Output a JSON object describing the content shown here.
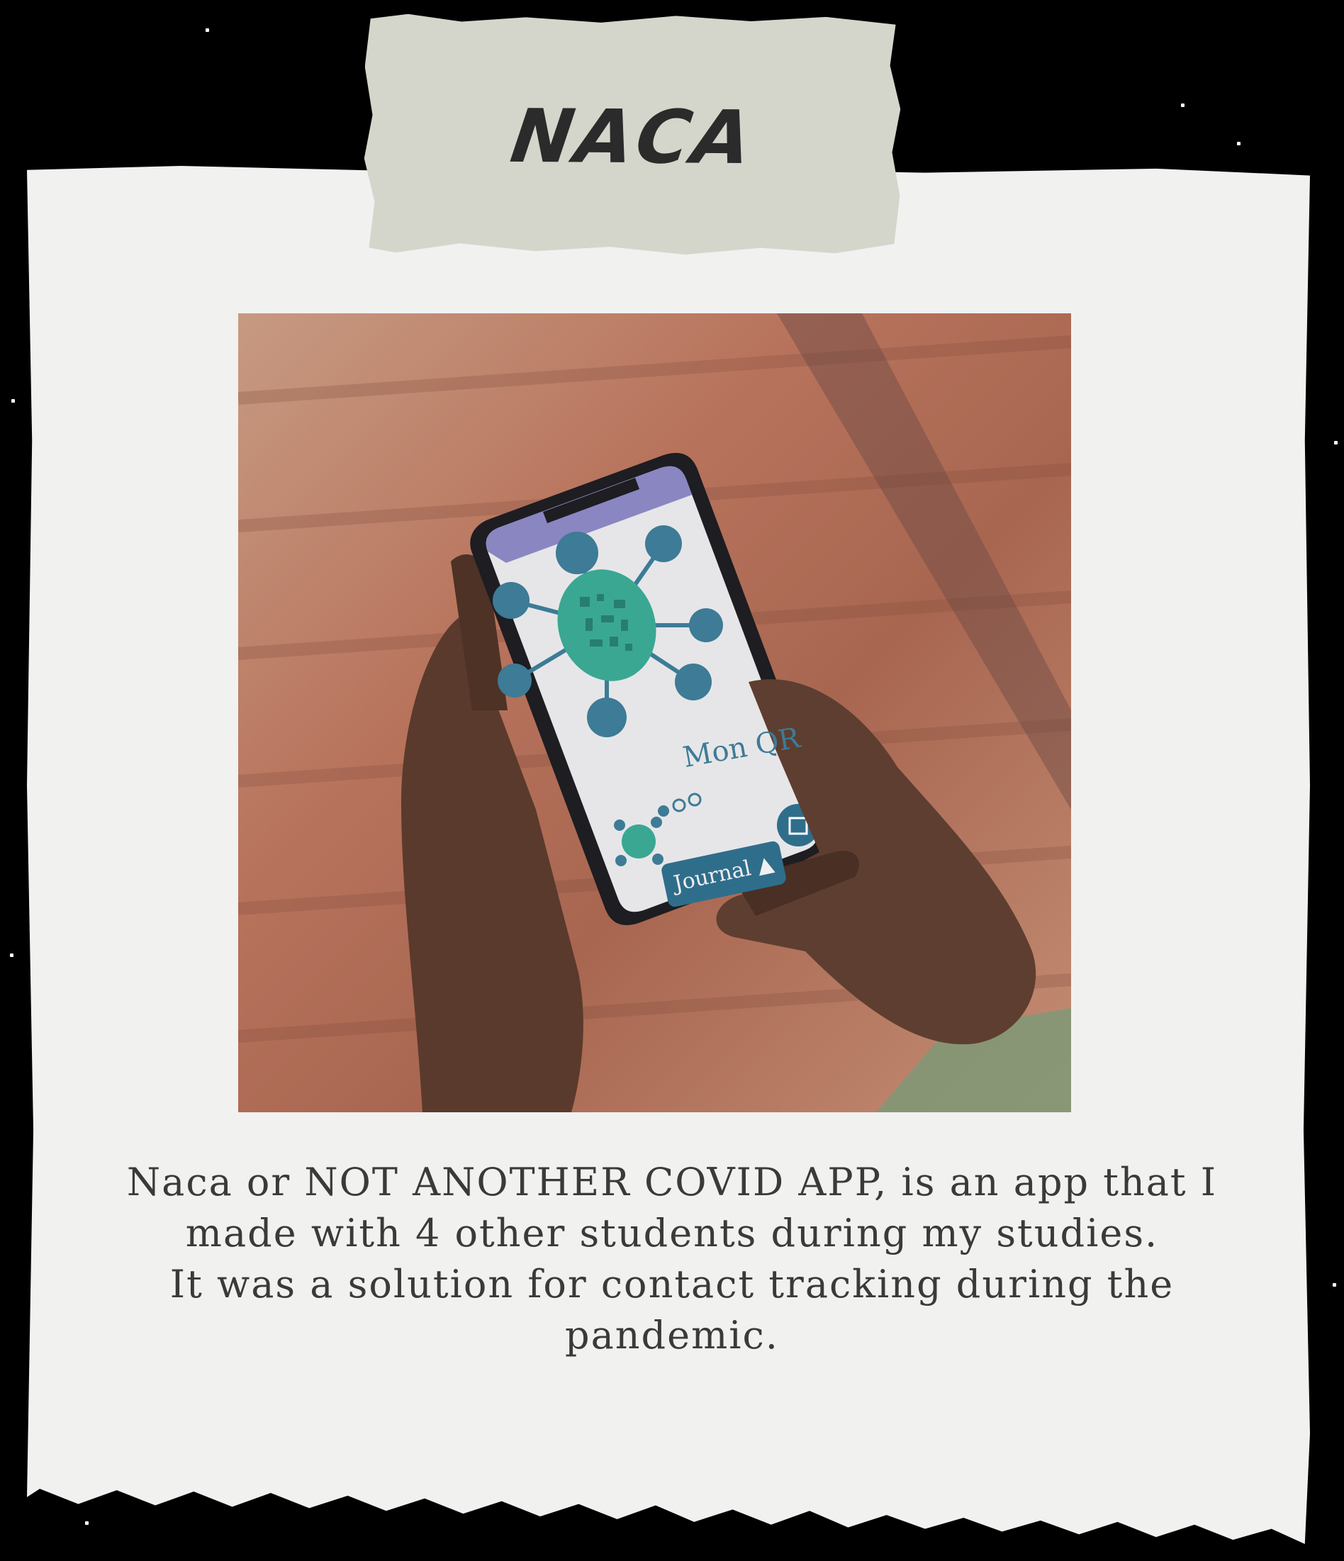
{
  "tape": {
    "logo_text": "NACA"
  },
  "phone_screen": {
    "title": "Mon QR",
    "journal_button_label": "Journal",
    "page_indicator_total": 3,
    "page_indicator_active": 1
  },
  "caption": {
    "line_1": "Naca or NOT ANOTHER COVID APP, is an app that I made with 4 other students during my studies.",
    "line_2": "It was a solution for contact tracking during the pandemic."
  },
  "colors": {
    "background": "#000000",
    "paper": "#f1f1f0",
    "tape": "#d5d6cb",
    "logo_text": "#2b2b2b",
    "caption_text": "#3a3a3a",
    "app_blue": "#3d7b96",
    "app_teal": "#3aa793"
  }
}
